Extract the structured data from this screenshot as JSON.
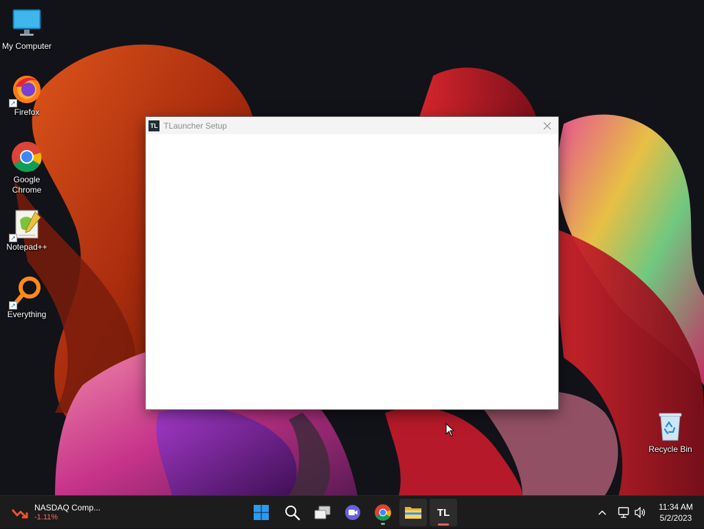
{
  "desktop": {
    "icons": [
      {
        "label": "My Computer",
        "icon": "monitor-icon"
      },
      {
        "label": "Firefox",
        "icon": "firefox-icon"
      },
      {
        "label": "Google Chrome",
        "icon": "chrome-icon"
      },
      {
        "label": "Notepad++",
        "icon": "notepadpp-icon"
      },
      {
        "label": "Everything",
        "icon": "everything-icon"
      },
      {
        "label": "Recycle Bin",
        "icon": "recycle-bin-icon"
      }
    ]
  },
  "window": {
    "logo": "TL",
    "title": "TLauncher Setup",
    "close_glyph": "close-icon"
  },
  "taskbar": {
    "widget": {
      "title": "NASDAQ Comp...",
      "change": "-1.11%",
      "change_color": "#ff6a6a"
    },
    "pinned": [
      {
        "name": "start-button",
        "icon": "windows-logo-icon"
      },
      {
        "name": "search-button",
        "icon": "search-icon"
      },
      {
        "name": "task-view-button",
        "icon": "task-view-icon"
      },
      {
        "name": "meet-button",
        "icon": "video-call-icon"
      },
      {
        "name": "chrome-button",
        "icon": "chrome-icon"
      },
      {
        "name": "file-explorer-button",
        "icon": "folder-icon"
      },
      {
        "name": "tlauncher-button",
        "icon": "tlauncher-icon",
        "label": "TL"
      }
    ],
    "tray": {
      "icons": [
        "chevron-up-icon",
        "network-icon",
        "volume-icon"
      ],
      "time": "11:34 AM",
      "date": "5/2/2023"
    }
  }
}
